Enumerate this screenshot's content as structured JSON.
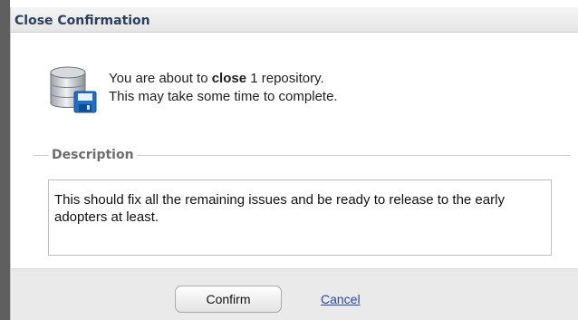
{
  "dialog": {
    "title": "Close Confirmation",
    "message_prefix": "You are about to ",
    "message_action": "close",
    "message_suffix": " 1 repository.",
    "message_line2": "This may take some time to complete.",
    "description_legend": "Description",
    "description_value": "This should fix all the remaining issues and be ready to release to the early adopters at least.",
    "confirm_label": "Confirm",
    "cancel_label": "Cancel",
    "icon": "repository-database-icon"
  },
  "colors": {
    "title": "#2b3f5c",
    "link": "#2347a8",
    "footer_bg": "#eaeaea"
  }
}
